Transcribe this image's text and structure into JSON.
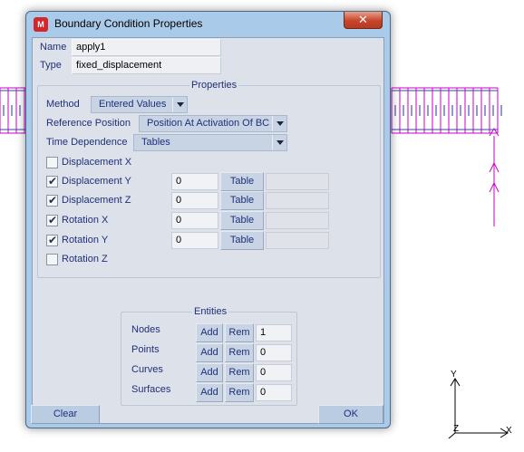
{
  "window": {
    "title": "Boundary Condition Properties",
    "app_icon_letter": "M",
    "close_glyph": "✕"
  },
  "header": {
    "name_label": "Name",
    "name_value": "apply1",
    "type_label": "Type",
    "type_value": "fixed_displacement"
  },
  "properties": {
    "group_title": "Properties",
    "method_label": "Method",
    "method_value": "Entered Values",
    "reference_position_label": "Reference Position",
    "reference_position_value": "Position At Activation Of BC",
    "time_dependence_label": "Time Dependence",
    "time_dependence_value": "Tables",
    "table_button_label": "Table",
    "dofs": [
      {
        "label": "Displacement X",
        "checked": false,
        "value": ""
      },
      {
        "label": "Displacement Y",
        "checked": true,
        "value": "0"
      },
      {
        "label": "Displacement Z",
        "checked": true,
        "value": "0"
      },
      {
        "label": "Rotation X",
        "checked": true,
        "value": "0"
      },
      {
        "label": "Rotation Y",
        "checked": true,
        "value": "0"
      },
      {
        "label": "Rotation Z",
        "checked": false,
        "value": ""
      }
    ]
  },
  "entities": {
    "group_title": "Entities",
    "add_label": "Add",
    "rem_label": "Rem",
    "rows": [
      {
        "label": "Nodes",
        "count": "1"
      },
      {
        "label": "Points",
        "count": "0"
      },
      {
        "label": "Curves",
        "count": "0"
      },
      {
        "label": "Surfaces",
        "count": "0"
      }
    ]
  },
  "footer": {
    "clear_label": "Clear",
    "ok_label": "OK"
  },
  "viewport": {
    "axis_y_label": "Y",
    "axis_x_label": "X",
    "axis_z_label": "Z",
    "bc_marker_color": "#c800c8"
  }
}
